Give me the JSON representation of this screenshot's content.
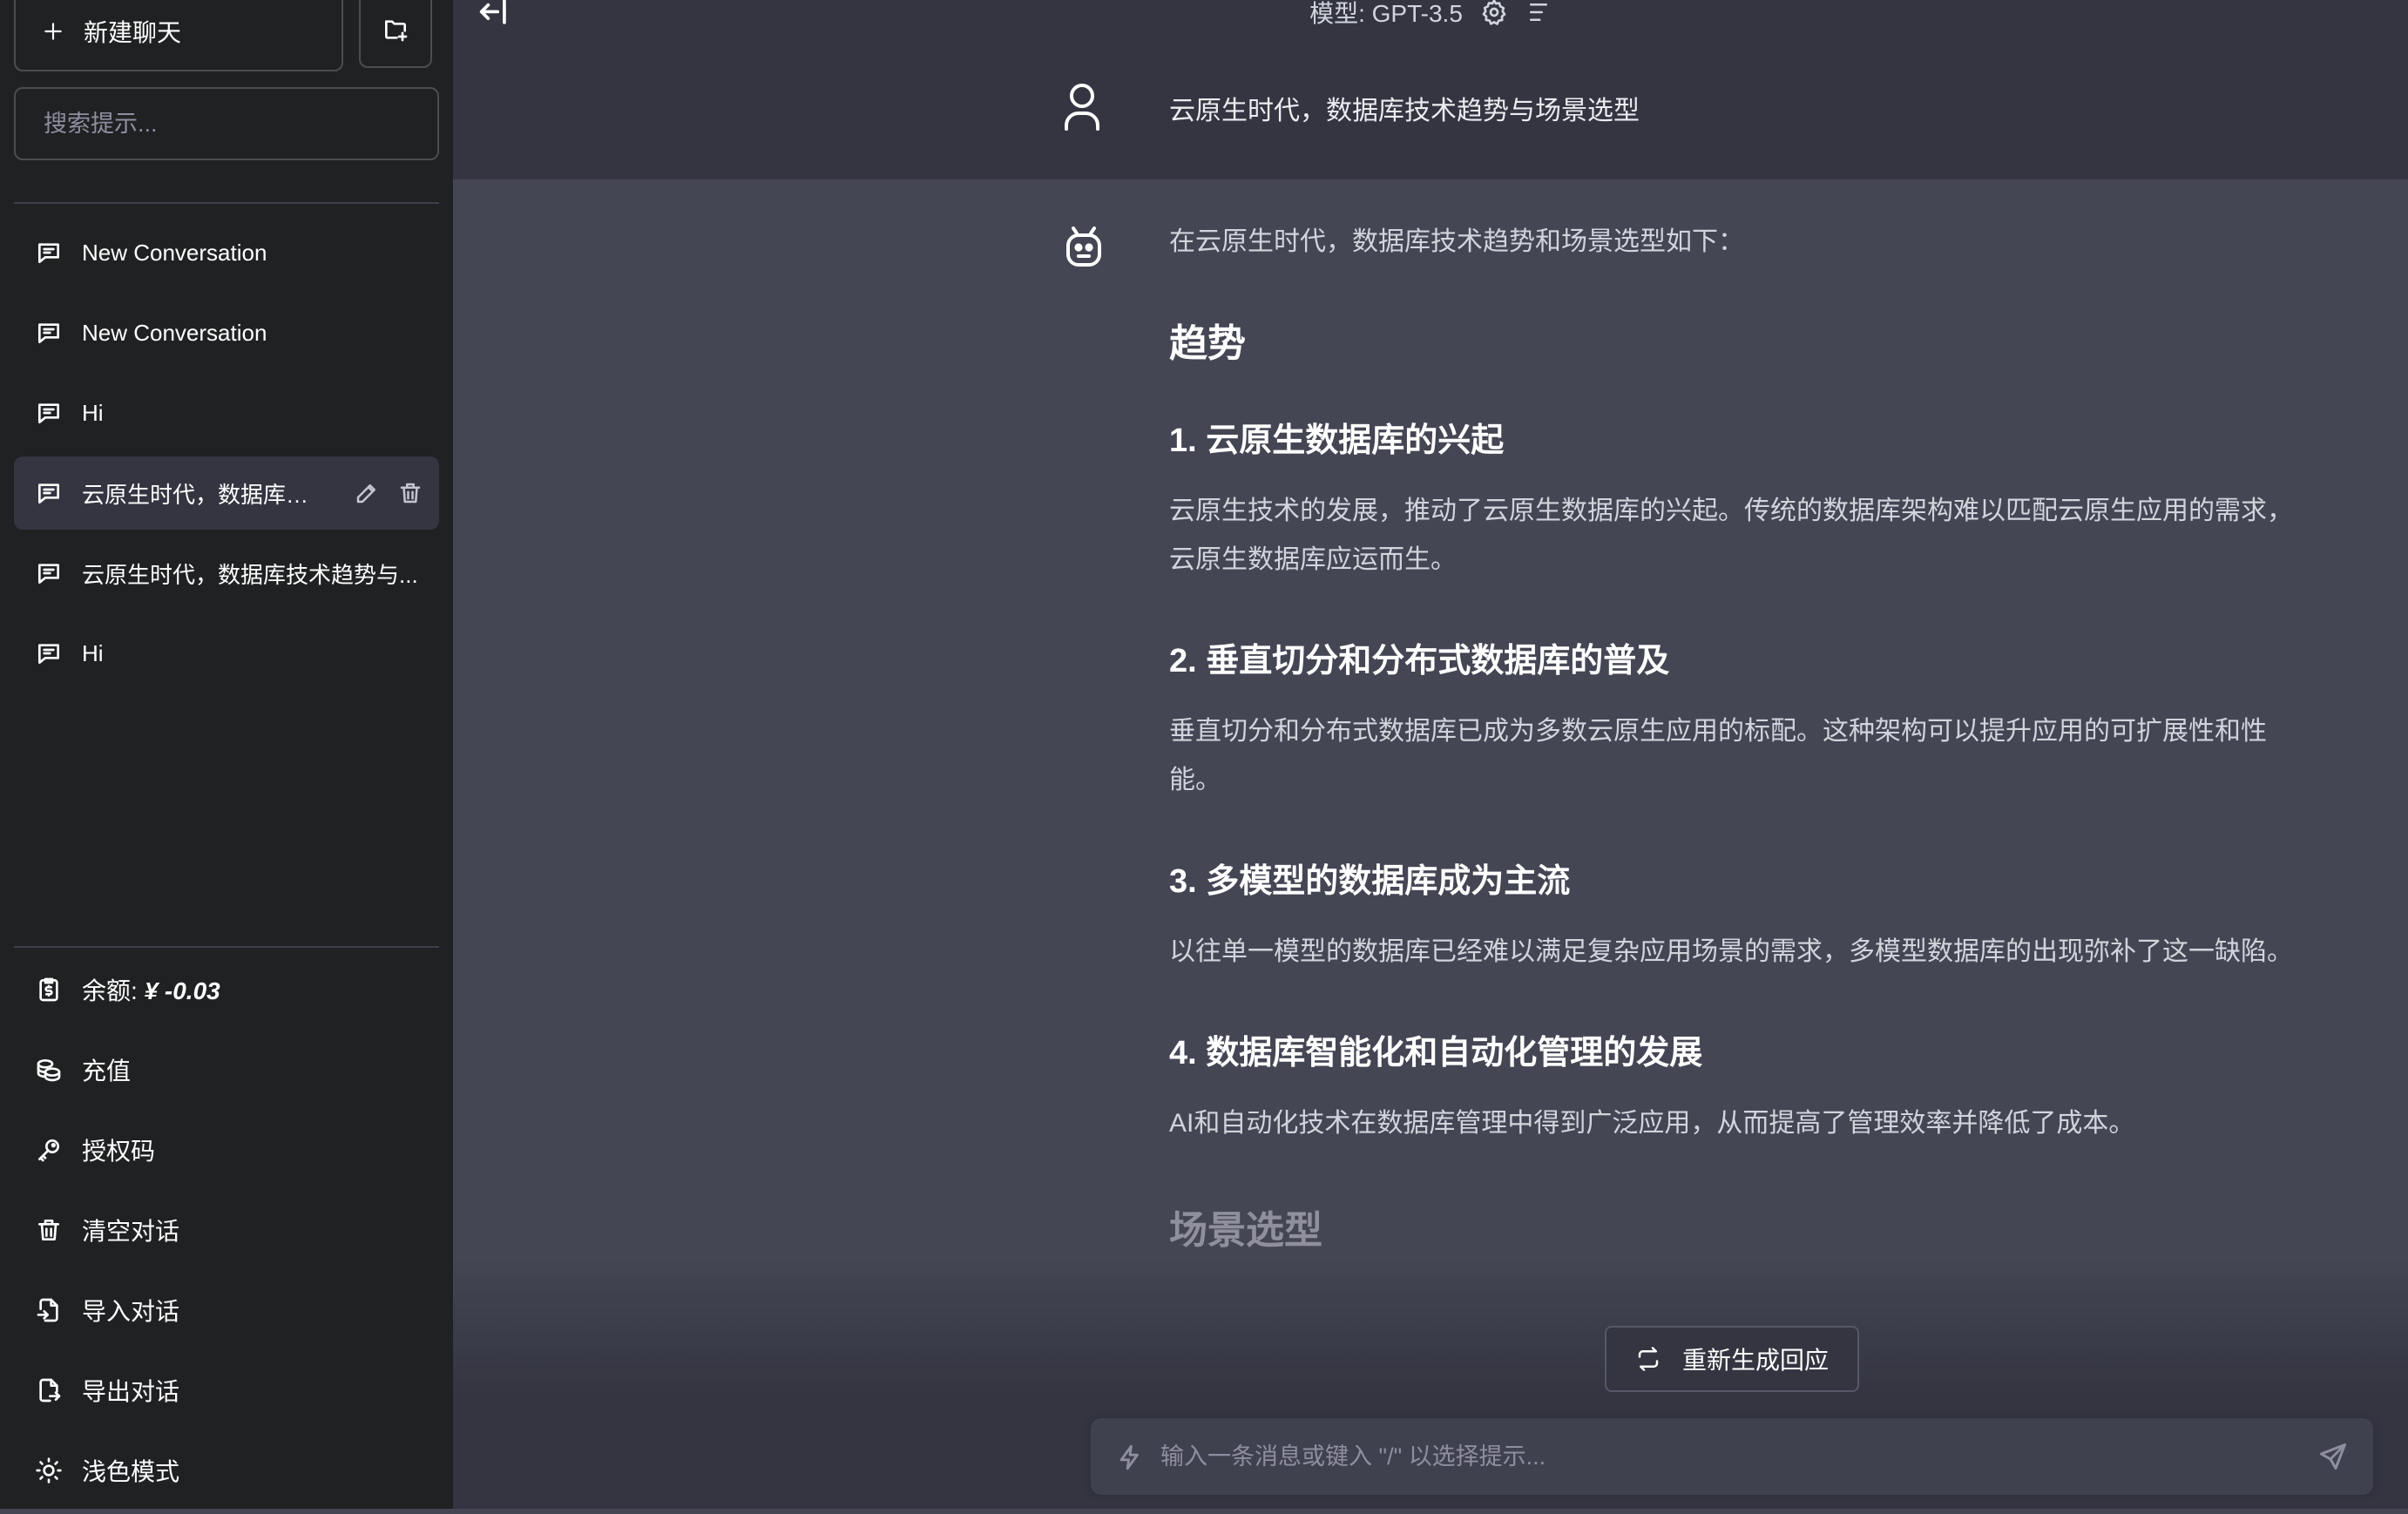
{
  "sidebar": {
    "new_chat_label": "新建聊天",
    "search_placeholder": "搜索提示...",
    "conversations": [
      {
        "label": "New Conversation"
      },
      {
        "label": "New Conversation"
      },
      {
        "label": "Hi"
      },
      {
        "label": "云原生时代，数据库技...",
        "active": true
      },
      {
        "label": "云原生时代，数据库技术趋势与..."
      },
      {
        "label": "Hi"
      }
    ],
    "balance_label": "余额: ",
    "balance_value": "¥ -0.03",
    "bottom_items": {
      "recharge": "充值",
      "auth_code": "授权码",
      "clear": "清空对话",
      "import": "导入对话",
      "export": "导出对话",
      "light_mode": "浅色模式"
    }
  },
  "topbar": {
    "model_label": "模型: GPT-3.5"
  },
  "messages": {
    "user_text": "云原生时代，数据库技术趋势与场景选型",
    "bot": {
      "intro": "在云原生时代，数据库技术趋势和场景选型如下：",
      "heading_trends": "趋势",
      "sections": [
        {
          "title": "1. 云原生数据库的兴起",
          "body": "云原生技术的发展，推动了云原生数据库的兴起。传统的数据库架构难以匹配云原生应用的需求，云原生数据库应运而生。"
        },
        {
          "title": "2. 垂直切分和分布式数据库的普及",
          "body": "垂直切分和分布式数据库已成为多数云原生应用的标配。这种架构可以提升应用的可扩展性和性能。"
        },
        {
          "title": "3. 多模型的数据库成为主流",
          "body": "以往单一模型的数据库已经难以满足复杂应用场景的需求，多模型数据库的出现弥补了这一缺陷。"
        },
        {
          "title": "4. 数据库智能化和自动化管理的发展",
          "body": "AI和自动化技术在数据库管理中得到广泛应用，从而提高了管理效率并降低了成本。"
        }
      ],
      "heading_scenarios": "场景选型"
    }
  },
  "regenerate_label": "重新生成回应",
  "input": {
    "placeholder": "输入一条消息或键入 \"/\" 以选择提示..."
  },
  "icons": {
    "new_chat": "plus-icon",
    "new_folder": "folder-plus-icon",
    "conversation": "message-icon",
    "edit": "pencil-icon",
    "delete": "trash-icon",
    "balance": "wallet-icon",
    "recharge": "coins-icon",
    "auth": "key-icon",
    "clear": "trash-icon",
    "import": "file-import-icon",
    "export": "file-export-icon",
    "theme": "sun-icon",
    "settings": "gear-icon",
    "menu": "menu-icon",
    "user": "user-icon",
    "bot": "robot-icon",
    "regenerate": "refresh-icon",
    "bolt": "bolt-icon",
    "send": "send-icon"
  }
}
